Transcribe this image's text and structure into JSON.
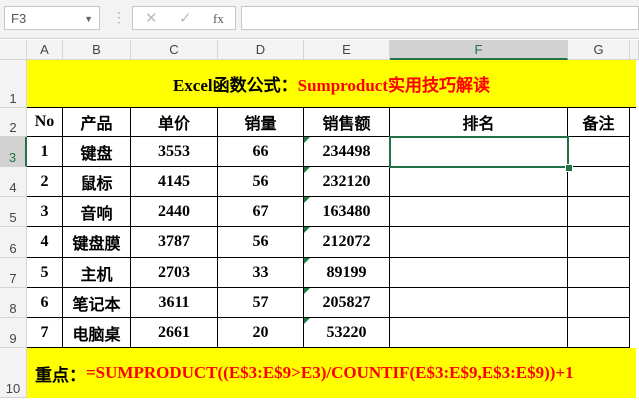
{
  "formula_bar": {
    "name_box": "F3",
    "formula": ""
  },
  "columns": [
    "A",
    "B",
    "C",
    "D",
    "E",
    "F",
    "G"
  ],
  "rows": [
    "1",
    "2",
    "3",
    "4",
    "5",
    "6",
    "7",
    "8",
    "9",
    "10"
  ],
  "title": {
    "black": "Excel函数公式：",
    "red": "Sumproduct实用技巧解读"
  },
  "headers": [
    "No",
    "产品",
    "单价",
    "销量",
    "销售额",
    "排名",
    "备注"
  ],
  "data": [
    [
      "1",
      "键盘",
      "3553",
      "66",
      "234498"
    ],
    [
      "2",
      "鼠标",
      "4145",
      "56",
      "232120"
    ],
    [
      "3",
      "音响",
      "2440",
      "67",
      "163480"
    ],
    [
      "4",
      "键盘膜",
      "3787",
      "56",
      "212072"
    ],
    [
      "5",
      "主机",
      "2703",
      "33",
      "89199"
    ],
    [
      "6",
      "笔记本",
      "3611",
      "57",
      "205827"
    ],
    [
      "7",
      "电脑桌",
      "2661",
      "20",
      "53220"
    ]
  ],
  "note": {
    "label": "重点：",
    "formula": "=SUMPRODUCT((E$3:E$9>E3)/COUNTIF(E$3:E$9,E$3:E$9))+1"
  }
}
